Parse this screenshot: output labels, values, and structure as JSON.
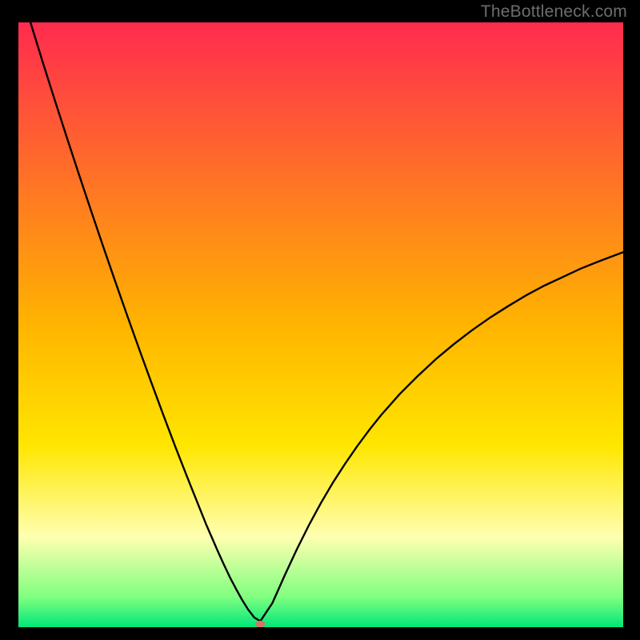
{
  "watermark": "TheBottleneck.com",
  "chart_data": {
    "type": "line",
    "title": "",
    "xlabel": "",
    "ylabel": "",
    "xlim": [
      0,
      100
    ],
    "ylim": [
      0,
      100
    ],
    "grid": false,
    "legend": false,
    "background_gradient": {
      "stops": [
        {
          "offset": 0.0,
          "color": "#ff2b4f"
        },
        {
          "offset": 0.5,
          "color": "#ffb400"
        },
        {
          "offset": 0.7,
          "color": "#ffe600"
        },
        {
          "offset": 0.85,
          "color": "#ffffb0"
        },
        {
          "offset": 0.95,
          "color": "#80ff80"
        },
        {
          "offset": 1.0,
          "color": "#00e67a"
        }
      ]
    },
    "series": [
      {
        "name": "bottleneck-curve",
        "type": "line",
        "color": "#000000",
        "x": [
          2,
          4,
          6,
          8,
          10,
          12,
          14,
          16,
          18,
          20,
          22,
          24,
          26,
          28,
          30,
          31,
          32,
          33,
          34,
          35,
          36,
          37,
          38,
          39,
          40,
          42,
          44,
          46,
          48,
          50,
          52,
          54,
          56,
          58,
          60,
          63,
          66,
          69,
          72,
          75,
          78,
          81,
          84,
          87,
          90,
          93,
          96,
          100
        ],
        "y": [
          100,
          93.5,
          87.2,
          81.0,
          74.9,
          68.9,
          63.0,
          57.2,
          51.5,
          45.9,
          40.4,
          35.0,
          29.7,
          24.6,
          19.6,
          17.1,
          14.8,
          12.5,
          10.3,
          8.2,
          6.3,
          4.5,
          2.9,
          1.6,
          1.0,
          4.0,
          8.5,
          12.8,
          16.8,
          20.5,
          23.9,
          27.0,
          29.9,
          32.6,
          35.1,
          38.5,
          41.5,
          44.3,
          46.8,
          49.1,
          51.2,
          53.1,
          54.9,
          56.5,
          57.9,
          59.3,
          60.5,
          62.0
        ]
      }
    ],
    "markers": [
      {
        "name": "min-point",
        "x": 40,
        "y": 0.5,
        "color": "#cc7a66"
      }
    ]
  }
}
